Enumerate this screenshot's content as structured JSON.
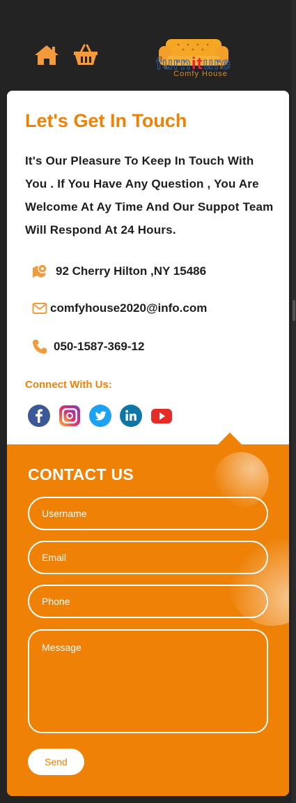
{
  "header": {
    "home_icon": "home-icon",
    "cart_icon": "basket-icon",
    "logo": {
      "word": "furniture",
      "word_start": "furn",
      "word_mid": "it",
      "word_end": "ure",
      "tagline": "Comfy House"
    }
  },
  "info": {
    "title": "Let's Get In Touch",
    "intro": "It's Our Pleasure To Keep In Touch With You . If You Have Any Question , You Are Welcome At Ay Time And Our Suppot Team Will Respond At 24 Hours.",
    "address": {
      "icon": "map-pin-icon",
      "text": "92 Cherry Hilton ,NY 15486"
    },
    "email": {
      "icon": "envelope-icon",
      "text": "comfyhouse2020@info.com"
    },
    "phone": {
      "icon": "phone-icon",
      "text": "050-1587-369-12"
    },
    "connect_label": "Connect With Us:",
    "socials": [
      "facebook-icon",
      "instagram-icon",
      "twitter-icon",
      "linkedin-icon",
      "youtube-icon"
    ]
  },
  "form": {
    "title": "CONTACT US",
    "username_placeholder": "Username",
    "email_placeholder": "Email",
    "phone_placeholder": "Phone",
    "message_placeholder": "Message",
    "send_label": "Send"
  },
  "colors": {
    "accent": "#ee8106",
    "background": "#232323",
    "text": "#1d1d1d"
  }
}
